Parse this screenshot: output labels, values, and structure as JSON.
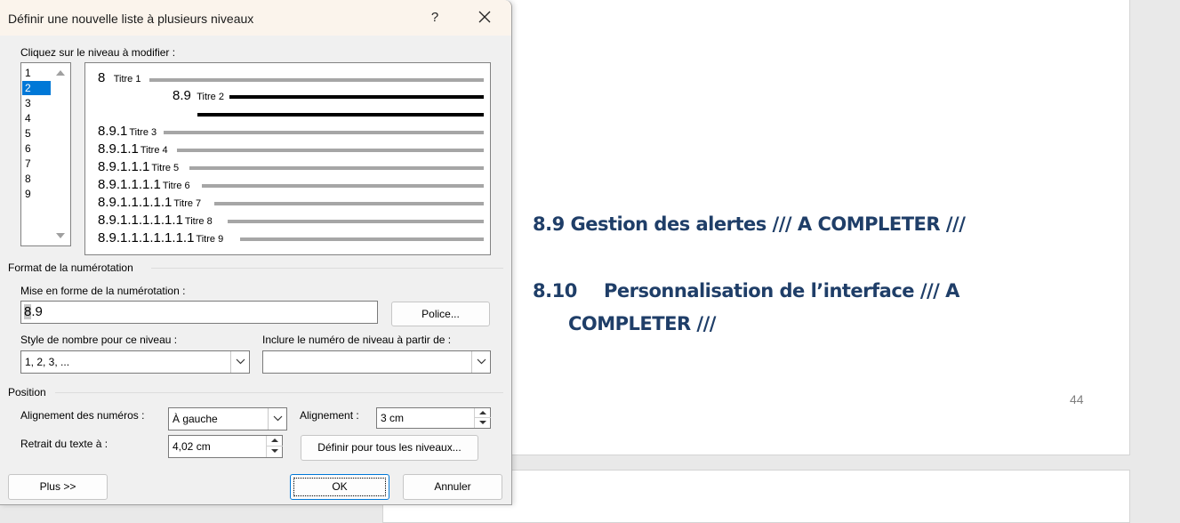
{
  "document": {
    "heading_1": "8.9 Gestion des alertes /// A COMPLETER ///",
    "heading_2_number": "8.10",
    "heading_2_text": "Personnalisation de l’interface /// A",
    "heading_2_line2": "COMPLETER ///",
    "page_number": "44",
    "heading_color": "#1f3e68"
  },
  "dialog": {
    "title": "Définir une nouvelle liste à plusieurs niveaux",
    "help_label": "?",
    "level_prompt": "Cliquez sur le niveau à modifier :",
    "levels": [
      "1",
      "2",
      "3",
      "4",
      "5",
      "6",
      "7",
      "8",
      "9"
    ],
    "selected_level": "2",
    "preview": [
      {
        "number": "8",
        "name": "Titre 1"
      },
      {
        "number": "8.9",
        "name": "Titre 2"
      },
      {
        "number": "8.9.1",
        "name": "Titre 3"
      },
      {
        "number": "8.9.1.1",
        "name": "Titre 4"
      },
      {
        "number": "8.9.1.1.1",
        "name": "Titre 5"
      },
      {
        "number": "8.9.1.1.1.1",
        "name": "Titre 6"
      },
      {
        "number": "8.9.1.1.1.1.1",
        "name": "Titre 7"
      },
      {
        "number": "8.9.1.1.1.1.1.1",
        "name": "Titre 8"
      },
      {
        "number": "8.9.1.1.1.1.1.1.1",
        "name": "Titre 9"
      }
    ],
    "format_section": "Format de la numérotation",
    "format_label": "Mise en forme de la numérotation :",
    "format_value_selected": "8",
    "format_value_rest": ".9",
    "font_button": "Police...",
    "number_style_label": "Style de nombre pour ce niveau :",
    "number_style_value": "1, 2, 3, ...",
    "include_level_label": "Inclure le numéro de niveau à partir de :",
    "include_level_value": "",
    "position_section": "Position",
    "number_alignment_label": "Alignement des numéros :",
    "number_alignment_value": "À gauche",
    "alignment_label": "Alignement :",
    "alignment_value": "3 cm",
    "text_indent_label": "Retrait du texte à :",
    "text_indent_value": "4,02 cm",
    "all_levels_button": "Définir pour tous les niveaux...",
    "more_button": "Plus >>",
    "ok_button": "OK",
    "cancel_button": "Annuler",
    "accent_color": "#0078d7"
  }
}
